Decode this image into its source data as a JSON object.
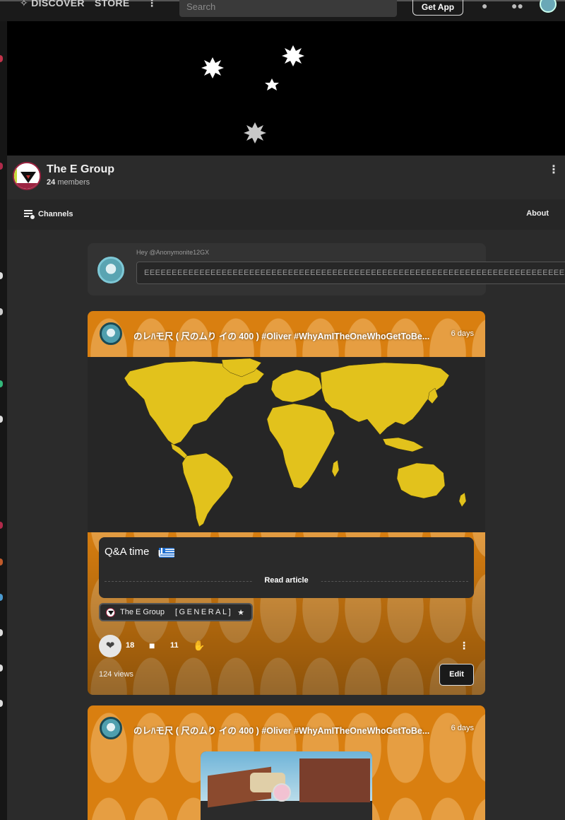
{
  "topnav": {
    "discover": "DISCOVER",
    "store": "STORE",
    "more_icon": "more-vertical-icon",
    "search_placeholder": "Search",
    "get_app": "Get App",
    "bell_icon": "bell-icon",
    "people_icon": "people-icon"
  },
  "community": {
    "name": "The E Group",
    "member_count": "24",
    "members_label": "members",
    "tabs": {
      "channels": "Channels",
      "about": "About"
    }
  },
  "composer": {
    "hint": "Hey @Anonymonite12GX",
    "input_value": "EEEEEEEEEEEEEEEEEEEEEEEEEEEEEEEEEEEEEEEEEEEEEEEEEEEEEEEEEEEEEEEEEEEEEEEEEEEEEEEEEE"
  },
  "posts": [
    {
      "title": "のレﾊモ尺 ( 尺のムり イの 400 ) #Oliver #WhyAmITheOneWhoGetToBe...",
      "time": "6 days",
      "article_title": "Q&A time",
      "read_label": "Read article",
      "chip_community": "The E Group",
      "chip_channel": "[GENERAL]",
      "likes": "18",
      "comments": "11",
      "views": "124 views",
      "edit": "Edit"
    },
    {
      "title": "のレﾊモ尺 ( 尺のムり イの 400 ) #Oliver #WhyAmITheOneWhoGetToBe...",
      "time": "6 days"
    }
  ],
  "colors": {
    "post_accent": "#d97f10",
    "map_land": "#e2c21c",
    "banner": "#000000"
  }
}
